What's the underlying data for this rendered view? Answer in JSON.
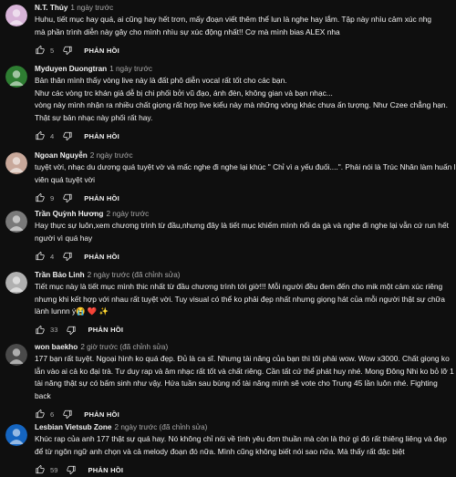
{
  "reply_label": "PHẢN HỒI",
  "comments": [
    {
      "author": "N.T. Thủy",
      "time": "1 ngày trước",
      "avatar_color": "#d8b4d8",
      "lines": [
        "Huhu, tiết mục hay quá, ai cũng hay hết trơn, mấy đoạn viết thêm thể lun là nghe hay lắm. Tập này nhìu cảm xúc nhg",
        "mà phần trình diễn này gây cho mình nhìu sự xúc động nhất!! Cơ mà mình bias ALEX nha"
      ],
      "likes": "5"
    },
    {
      "author": "Myduyen Duongtran",
      "time": "1 ngày trước",
      "avatar_color": "#2e7d32",
      "lines": [
        "Bản thân mình thấy vòng live này là đất phô diễn vocal rất tốt cho các bạn.",
        "Như các vòng trc khán giả dễ bị chi phối bởi vũ đạo, ánh đèn, không gian và bạn nhạc...",
        "vòng này mình nhận ra nhiều chất giọng rất hợp live kiểu này mà những vòng khác chưa ấn tượng. Như Czee chẳng hạn.",
        "Thật sự bản nhạc này phối rất hay."
      ],
      "likes": "4"
    },
    {
      "author": "Ngoan Nguyễn",
      "time": "2 ngày trước",
      "avatar_color": "#c8a89a",
      "lines": [
        "tuyệt vời, nhạc du dương quá tuyệt vờ và mấc nghe đi nghe lại khúc \" Chỉ vì a yếu đuối....\". Phải nói là Trúc Nhân làm huấn luyện",
        "viên quá tuyệt vời"
      ],
      "likes": "9"
    },
    {
      "author": "Trần Quỳnh Hương",
      "time": "2 ngày trước",
      "avatar_color": "#7a7a7a",
      "lines": [
        "Hay thực sự luôn,xem chương trình từ đầu,nhưng đây là tiết mục khiếm mình nổi da gà và nghe đi nghe lại vẫn cứ run hết",
        "người vì quá hay"
      ],
      "likes": "4"
    },
    {
      "author": "Trần Bảo Linh",
      "time": "2 ngày trước (đã chỉnh sửa)",
      "avatar_color": "#b0b0b0",
      "lines": [
        "Tiết mục này là tiết mục mình thic nhất từ đầu chương trình tới giờ!!! Mỗi người đều đem đến cho mik một cảm xúc riêng",
        "nhưng khi kết hợp với nhau rất tuyệt vời. Tuy visual có thể ko phải đẹp nhất nhưng giọng hát của mỗi người thật sự chữa",
        "lành lunnn ý😭 ❤️ ✨"
      ],
      "likes": "33"
    },
    {
      "author": "won baekho",
      "time": "2 giờ trước (đã chỉnh sửa)",
      "avatar_color": "#4a4a4a",
      "lines": [
        "177 bạn rất tuyệt. Ngoại hình ko quá đẹp. Đủ là ca sĩ. Nhưng tài năng của bạn thì tôi phải wow. Wow x3000. Chất giọng ko",
        "lẫn vào ai cả ko đại trà. Tư duy rap và âm nhạc rất tốt và chất riêng. Cần tất cứ thể phát huy nhé. Mong Đông Nhi ko bỏ lỡ 1",
        "tài năng thật sự có bấm sinh như vậy. Hứa tuần sau bùng nổ tài năng mình sẽ vote cho Trung 45 lần luôn nhé. Fighting",
        "back"
      ],
      "likes": "6"
    },
    {
      "author": "Lesbian Vietsub Zone",
      "time": "2 ngày trước (đã chỉnh sửa)",
      "avatar_color": "#1565c0",
      "lines": [
        "Khúc rap của anh 177 thật sự quá hay. Nó không chỉ nói về tình yêu đơn thuần mà còn là thứ gì đó rất thiêng liêng và đẹp",
        "để từ ngôn ngữ anh chọn và cả melody đoạn đó nữa. Mình cũng không biết nói sao nữa. Mà thấy rất đặc biệt"
      ],
      "likes": "59"
    }
  ]
}
